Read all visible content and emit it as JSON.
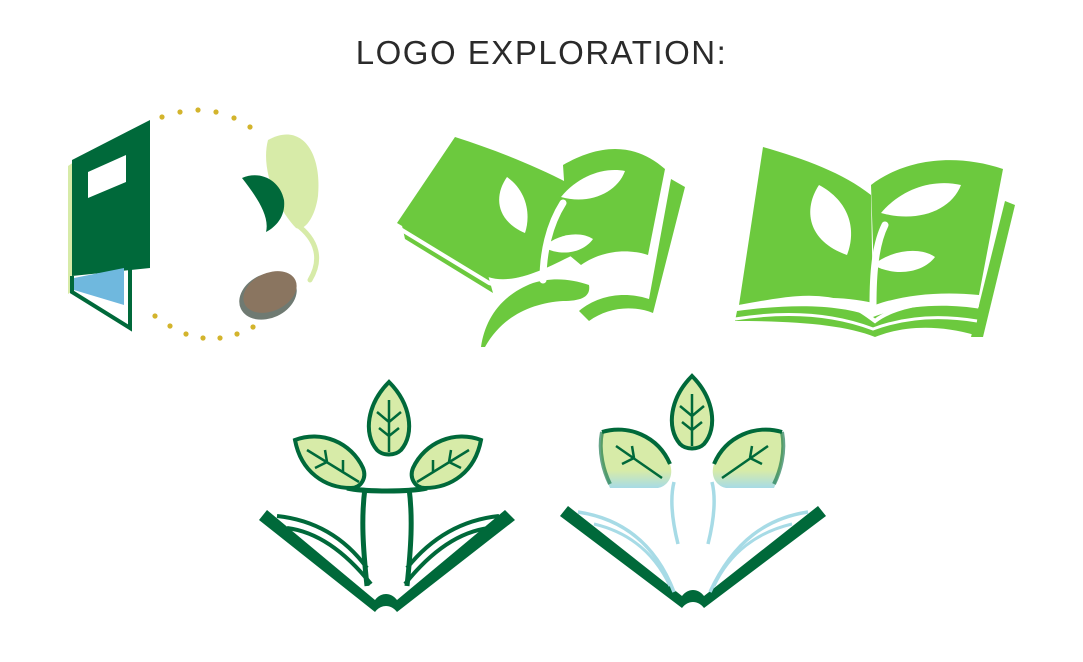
{
  "title": "LOGO EXPLORATION:",
  "colors": {
    "dark_green": "#00693a",
    "bright_green": "#6cc93e",
    "pale_green": "#d7eba8",
    "light_blue": "#6fb8de",
    "pale_blue": "#a7dbe6",
    "gold": "#d3b42c",
    "seed_brown": "#8a7560",
    "seed_gray": "#6f7a72"
  },
  "logos": [
    {
      "icon": "book-seed-sprout-icon"
    },
    {
      "icon": "open-book-sprout-icon"
    },
    {
      "icon": "open-book-sprout-flat-icon"
    },
    {
      "icon": "book-three-leaves-icon"
    },
    {
      "icon": "book-three-leaves-transparent-icon"
    }
  ]
}
